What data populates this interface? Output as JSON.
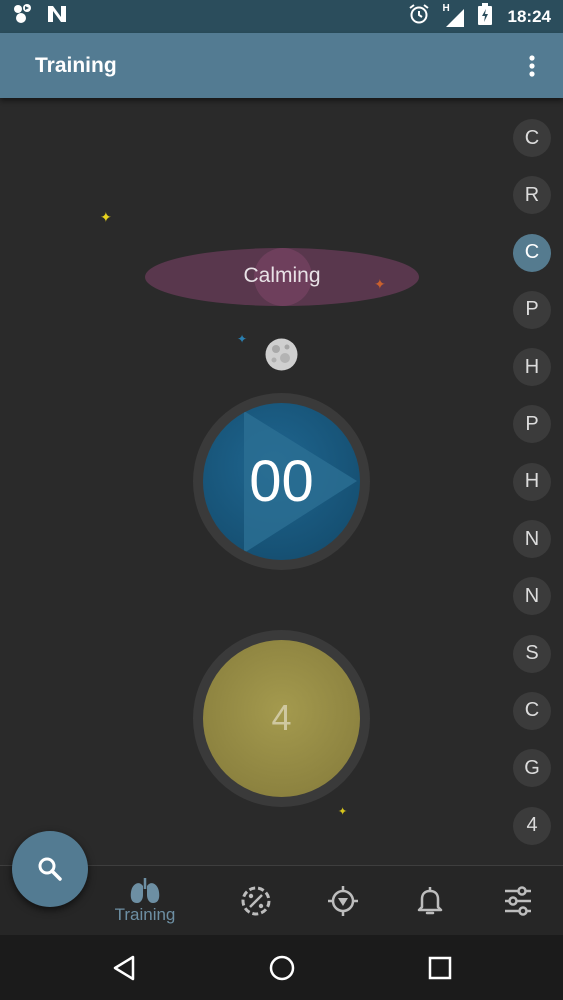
{
  "status_bar": {
    "time": "18:24",
    "left_icons": [
      "app-notification-icon",
      "n-notification-icon"
    ],
    "right_icons": [
      "alarm-icon",
      "signal-icon",
      "battery-charging-icon"
    ],
    "signal_label": "H"
  },
  "app_bar": {
    "title": "Training",
    "menu_icon": "more-vertical-icon",
    "color": "#537b92"
  },
  "sidebar": {
    "items": [
      {
        "label": "C",
        "active": false
      },
      {
        "label": "R",
        "active": false
      },
      {
        "label": "C",
        "active": true
      },
      {
        "label": "P",
        "active": false
      },
      {
        "label": "H",
        "active": false
      },
      {
        "label": "P",
        "active": false
      },
      {
        "label": "H",
        "active": false
      },
      {
        "label": "N",
        "active": false
      },
      {
        "label": "N",
        "active": false
      },
      {
        "label": "S",
        "active": false
      },
      {
        "label": "C",
        "active": false
      },
      {
        "label": "G",
        "active": false
      },
      {
        "label": "4",
        "active": false
      }
    ]
  },
  "main": {
    "mode_label": "Calming",
    "moon_icon": "moon-icon",
    "timer_value": "00",
    "timer_color": "#1a5a80",
    "count_value": "4",
    "count_color": "#8d8340"
  },
  "bottom_nav": {
    "items": [
      {
        "label": "Training",
        "icon": "lungs-icon",
        "active": true
      },
      {
        "label": "",
        "icon": "percent-dial-icon"
      },
      {
        "label": "",
        "icon": "compass-icon"
      },
      {
        "label": "",
        "icon": "bell-icon"
      },
      {
        "label": "",
        "icon": "sliders-icon"
      }
    ]
  },
  "fab": {
    "icon": "search-icon",
    "color": "#537b92"
  },
  "system_nav": {
    "icons": [
      "back-icon",
      "home-icon",
      "recents-icon"
    ]
  }
}
